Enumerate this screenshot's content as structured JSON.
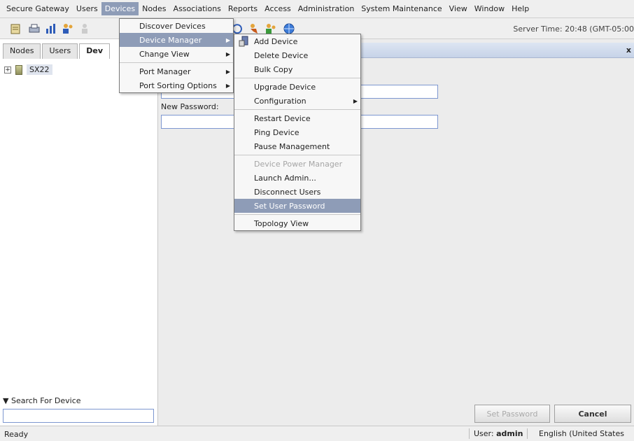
{
  "menubar": {
    "items": [
      "Secure Gateway",
      "Users",
      "Devices",
      "Nodes",
      "Associations",
      "Reports",
      "Access",
      "Administration",
      "System Maintenance",
      "View",
      "Window",
      "Help"
    ]
  },
  "toolbar": {
    "server_time": "Server Time: 20:48 (GMT-05:00"
  },
  "left_panel": {
    "tabs": [
      "Nodes",
      "Users",
      "Dev"
    ],
    "tree_device": "SX22",
    "search_label": "▼ Search For Device"
  },
  "form": {
    "new_password_label": "New Password:",
    "set_password_button": "Set Password",
    "cancel_button": "Cancel",
    "close_glyph": "x"
  },
  "devices_menu": {
    "items": [
      "Discover Devices",
      "Device Manager",
      "Change View",
      "Port Manager",
      "Port Sorting Options"
    ]
  },
  "device_manager_menu": {
    "items": [
      "Add Device",
      "Delete Device",
      "Bulk Copy",
      "Upgrade Device",
      "Configuration",
      "Restart Device",
      "Ping Device",
      "Pause Management",
      "Device Power Manager",
      "Launch Admin...",
      "Disconnect Users",
      "Set User Password",
      "Topology View"
    ]
  },
  "status": {
    "ready": "Ready",
    "user_prefix": "User:",
    "user_name": "admin",
    "language": "English (United States"
  },
  "colors": {
    "highlight": "#8e9cb7",
    "field_border": "#7d97d0"
  }
}
